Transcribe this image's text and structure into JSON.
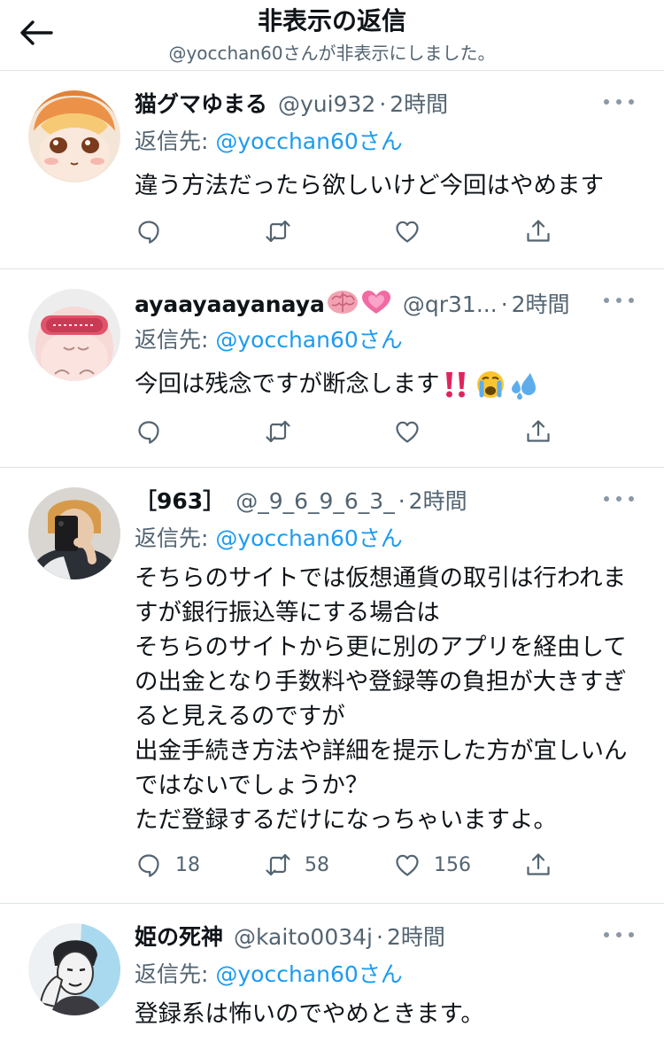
{
  "header": {
    "title": "非表示の返信",
    "subtitle": "@yocchan60さんが非表示にしました。"
  },
  "tweets": [
    {
      "name": "猫グマゆまる",
      "handle": "@yui932",
      "time": "2時間",
      "reply_prefix": "返信先: ",
      "reply_mention": "@yocchan60さん",
      "text": "違う方法だったら欲しいけど今回はやめます",
      "counts": {
        "reply": "",
        "retweet": "",
        "like": ""
      }
    },
    {
      "name": "ayaayaayanaya",
      "name_emojis": [
        "brain-emoji",
        "growing-heart-emoji"
      ],
      "handle": "@qr31...",
      "time": "2時間",
      "reply_prefix": "返信先: ",
      "reply_mention": "@yocchan60さん",
      "text": "今回は残念ですが断念します",
      "text_emojis": [
        "double-exclamation-emoji",
        "crying-face-emoji",
        "sweat-droplets-emoji"
      ],
      "counts": {
        "reply": "",
        "retweet": "",
        "like": ""
      }
    },
    {
      "name": "［963］",
      "handle": "@_9_6_9_6_3_",
      "time": "2時間",
      "reply_prefix": "返信先: ",
      "reply_mention": "@yocchan60さん",
      "text": "そちらのサイトでは仮想通貨の取引は行われますが銀行振込等にする場合は\nそちらのサイトから更に別のアプリを経由しての出金となり手数料や登録等の負担が大きすぎると見えるのですが\n出金手続き方法や詳細を提示した方が宜しいんではないでしょうか？\nただ登録するだけになっちゃいますよ。",
      "counts": {
        "reply": "18",
        "retweet": "58",
        "like": "156"
      }
    },
    {
      "name": "姫の死神",
      "handle": "@kaito0034j",
      "time": "2時間",
      "reply_prefix": "返信先: ",
      "reply_mention": "@yocchan60さん",
      "text": "登録系は怖いのでやめときます。"
    }
  ],
  "colors": {
    "accent": "#1d9bf0",
    "secondary_text": "#536471",
    "divider": "#dfe3e6"
  },
  "icons": {
    "back": "arrow-left-icon",
    "more": "more-dots-icon",
    "reply": "speech-bubble-icon",
    "retweet": "retweet-icon",
    "like": "heart-icon",
    "share": "share-upload-icon"
  }
}
